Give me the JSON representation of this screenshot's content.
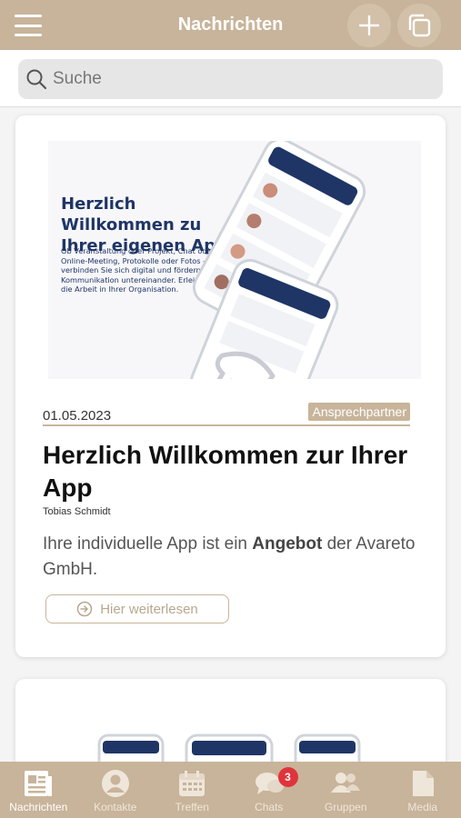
{
  "header": {
    "title": "Nachrichten"
  },
  "search": {
    "placeholder": "Suche"
  },
  "post": {
    "promo_title": "Herzlich Willkommen zu Ihrer eigenen App",
    "promo_text": "Ob Veranstaltung oder Projekt, Chat oder Online-Meeting, Protokolle oder Fotos - verbinden Sie sich digital und fördern Sie die Kommunikation untereinander. Erleichtern Sie die Arbeit in Ihrer Organisation.",
    "date": "01.05.2023",
    "category": "Ansprechpartner",
    "title": "Herzlich Willkommen zur Ihrer App",
    "author": "Tobias Schmidt",
    "teaser_before": "Ihre individuelle App ist ein ",
    "teaser_bold": "Angebot",
    "teaser_after": " der Avareto GmbH.",
    "read_more": "Hier weiterlesen"
  },
  "nav": {
    "items": [
      {
        "label": "Nachrichten",
        "icon": "newspaper-icon"
      },
      {
        "label": "Kontakte",
        "icon": "person-icon"
      },
      {
        "label": "Treffen",
        "icon": "calendar-icon"
      },
      {
        "label": "Chats",
        "icon": "chat-icon",
        "badge": "3"
      },
      {
        "label": "Gruppen",
        "icon": "group-icon"
      },
      {
        "label": "Media",
        "icon": "document-icon"
      }
    ]
  },
  "colors": {
    "accent": "#c8b49a",
    "promo_blue": "#1f3566",
    "badge_red": "#e0343c"
  }
}
